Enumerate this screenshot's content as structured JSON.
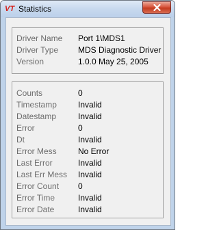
{
  "window": {
    "title": "Statistics",
    "logo_text": "VT"
  },
  "driver_info": [
    {
      "label": "Driver Name",
      "value": "Port 1\\MDS1"
    },
    {
      "label": "Driver Type",
      "value": "MDS Diagnostic Driver"
    },
    {
      "label": "Version",
      "value": "1.0.0 May 25, 2005"
    }
  ],
  "stats": [
    {
      "label": "Counts",
      "value": "0"
    },
    {
      "label": "Timestamp",
      "value": "Invalid"
    },
    {
      "label": "Datestamp",
      "value": "Invalid"
    },
    {
      "label": "Error",
      "value": "0"
    },
    {
      "label": "Dt",
      "value": "Invalid"
    },
    {
      "label": "Error Mess",
      "value": "No Error"
    },
    {
      "label": "Last Error",
      "value": "Invalid"
    },
    {
      "label": "Last Err Mess",
      "value": "Invalid"
    },
    {
      "label": "Error Count",
      "value": "0"
    },
    {
      "label": "Error Time",
      "value": "Invalid"
    },
    {
      "label": "Error Date",
      "value": "Invalid"
    }
  ],
  "colors": {
    "logo": "#d6201a",
    "label": "#6d6d6d",
    "close_button": "#c43b1f"
  },
  "icons": {
    "logo": "vt-logo-icon",
    "close": "close-icon"
  }
}
